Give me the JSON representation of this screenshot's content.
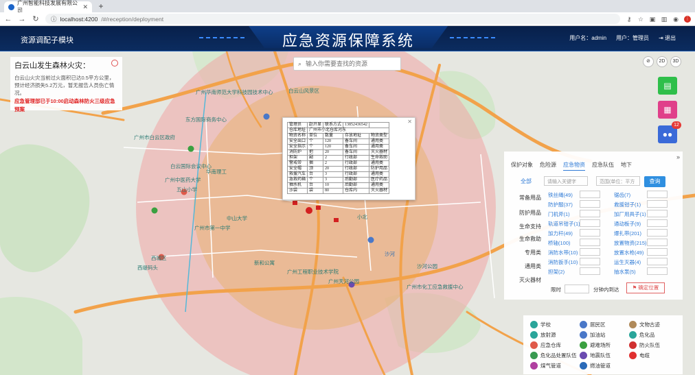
{
  "browser": {
    "tab_title": "广州智能科技发展有限公司",
    "url_host": "localhost:4200",
    "url_path": "/#/reception/deployment"
  },
  "header": {
    "module": "资源调配子模块",
    "title": "应急资源保障系统",
    "username": "用户名：admin",
    "role": "用户：管理员",
    "logout": "退出"
  },
  "fire_panel": {
    "title": "白云山发生森林火灾：",
    "desc1": "白云山火灾当前过火面积已达0.5平方公里，",
    "desc2": "预计经济损失5.2万元，暂无报告人员伤亡情况。",
    "warn1": "应急管理部已于10:00启动森林防火三级应急",
    "warn2": "预案"
  },
  "search": {
    "placeholder": "输入你需要查找的资源"
  },
  "view": {
    "d2": "2D",
    "d3": "3D"
  },
  "side": {
    "badge": "12"
  },
  "popup": {
    "rows": [
      [
        "管理员",
        "赵开显",
        "联系方式",
        "13852436542",
        ""
      ],
      [
        "仓库地址",
        "",
        "广州市小北仓库河东",
        "",
        ""
      ],
      [
        "物资名称",
        "单位",
        "数量",
        "存放地址",
        "物资类型"
      ],
      [
        "安全出口",
        "个",
        "120",
        "备车间",
        "通用类"
      ],
      [
        "安全指示",
        "个",
        "120",
        "备车间",
        "通用类"
      ],
      [
        "消防炉",
        "把",
        "20",
        "备车间",
        "灭火器材"
      ],
      [
        "担架",
        "副",
        "2",
        "行政部",
        "生命救助"
      ],
      [
        "警戒带",
        "捆",
        "2",
        "行政部",
        "通用类"
      ],
      [
        "安全帽",
        "顶",
        "20",
        "行政部",
        "防护用品"
      ],
      [
        "救援汽车",
        "台",
        "3",
        "行政部",
        "通用类"
      ],
      [
        "急救药箱",
        "个",
        "3",
        "后勤部",
        "医疗药品"
      ],
      [
        "抽水机",
        "台",
        "10",
        "后勤部",
        "通用类"
      ],
      [
        "沙袋",
        "袋",
        "80",
        "仓库内",
        "灭火器材"
      ]
    ]
  },
  "resource": {
    "tabs": [
      "保护对象",
      "危险源",
      "应急物资",
      "应急队伍",
      "地下"
    ],
    "all_label": "全部",
    "keyword_placeholder": "请输入关键字",
    "range_placeholder": "范围(单位：平方",
    "query": "查询",
    "categories": [
      "常备用品",
      "防护用品",
      "生命支持",
      "生命救助",
      "专用类",
      "通用类",
      "灭火器材"
    ],
    "items": [
      "铁丝绳(49)",
      "锯齿(7)",
      "防护服(37)",
      "救援钳子(1)",
      "门机斧(1)",
      "加厂用具子(1)",
      "轨道吊钳子(1)",
      "通动板子(9)",
      "加力杆(49)",
      "爆扎带(201)",
      "桥轴(100)",
      "放置物资(215)",
      "消防水带(10)",
      "放置水枪(49)",
      "消防扳手(10)",
      "运生灭器(4)",
      "担架(2)",
      "抽水泵(5)"
    ],
    "time_label": "限时",
    "time_suffix": "分钟内到达",
    "confirm": "确定位置"
  },
  "legend": [
    {
      "label": "学校",
      "icon": "school-icon",
      "color": "#2aa59a"
    },
    {
      "label": "居民区",
      "icon": "residential-icon",
      "color": "#4a78c8"
    },
    {
      "label": "文物古迹",
      "icon": "heritage-icon",
      "color": "#b08a5a"
    },
    {
      "label": "放射源",
      "icon": "radiation-icon",
      "color": "#2aa59a"
    },
    {
      "label": "加油站",
      "icon": "gas-station-icon",
      "color": "#4a78c8"
    },
    {
      "label": "危化品",
      "icon": "hazmat-icon",
      "color": "#2aa59a"
    },
    {
      "label": "应急仓库",
      "icon": "warehouse-icon",
      "color": "#e05a4a"
    },
    {
      "label": "避难场所",
      "icon": "shelter-icon",
      "color": "#3aa040"
    },
    {
      "label": "防火队伍",
      "icon": "fire-team-icon",
      "color": "#d03030"
    },
    {
      "label": "危化品处置队伍",
      "icon": "hazmat-team-icon",
      "color": "#3a9a50"
    },
    {
      "label": "地震队伍",
      "icon": "earthquake-team-icon",
      "color": "#6a4ab0"
    },
    {
      "label": "电缆",
      "icon": "cable-icon",
      "color": "#e03030"
    },
    {
      "label": "煤气管道",
      "icon": "gas-pipe-icon",
      "color": "#b040a0"
    },
    {
      "label": "燃油管道",
      "icon": "oil-pipe-icon",
      "color": "#2a6ab8"
    }
  ],
  "map_labels": [
    "广州华南师范大学科技园技术中心",
    "白云山风景区",
    "东方国际商务中心",
    "广州市白云区政府",
    "白云国际会议中心",
    "华南理工",
    "广州中医药大学",
    "五山小学",
    "中山大学",
    "广州市第一中学",
    "西城区",
    "西堤码头",
    "新和公寓",
    "广州工程职业技术学院",
    "广州天河公园",
    "沙河",
    "沙河公园",
    "广州市化工应急救援中心",
    "小北"
  ]
}
